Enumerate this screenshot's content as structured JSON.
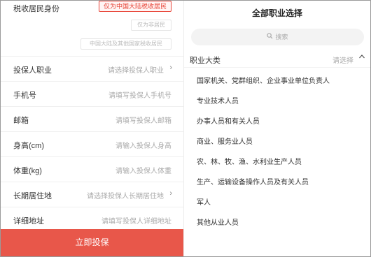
{
  "form": {
    "tax_resident": {
      "label": "税收居民身份",
      "options": [
        "仅为中国大陆税收居民",
        "仅为非居民",
        "中国大陆及其他国家税收居民"
      ]
    },
    "rows": [
      {
        "label": "投保人职业",
        "placeholder": "请选择投保人职业",
        "has_arrow": true
      },
      {
        "label": "手机号",
        "placeholder": "请填写投保人手机号",
        "has_arrow": false
      },
      {
        "label": "邮箱",
        "placeholder": "请填写投保人邮箱",
        "has_arrow": false
      },
      {
        "label": "身高(cm)",
        "placeholder": "请输入投保人身高",
        "has_arrow": false
      },
      {
        "label": "体重(kg)",
        "placeholder": "请输入投保人体重",
        "has_arrow": false
      },
      {
        "label": "长期居住地",
        "placeholder": "请选择投保人长期居住地",
        "has_arrow": true
      },
      {
        "label": "详细地址",
        "placeholder": "请填写投保人详细地址",
        "has_arrow": false
      }
    ],
    "submit_label": "立即投保"
  },
  "panel": {
    "title": "全部职业选择",
    "search_placeholder": "搜索",
    "category": {
      "label": "职业大类",
      "value": "请选择",
      "icon": "chevron-up-icon"
    },
    "options": [
      "国家机关、党群组织、企业事业单位负责人",
      "专业技术人员",
      "办事人员和有关人员",
      "商业、服务业人员",
      "农、林、牧、渔、水利业生产人员",
      "生产、运输设备操作人员及有关人员",
      "军人",
      "其他从业人员"
    ]
  },
  "colors": {
    "accent": "#e8574a",
    "active_chip": "#e8463a"
  }
}
